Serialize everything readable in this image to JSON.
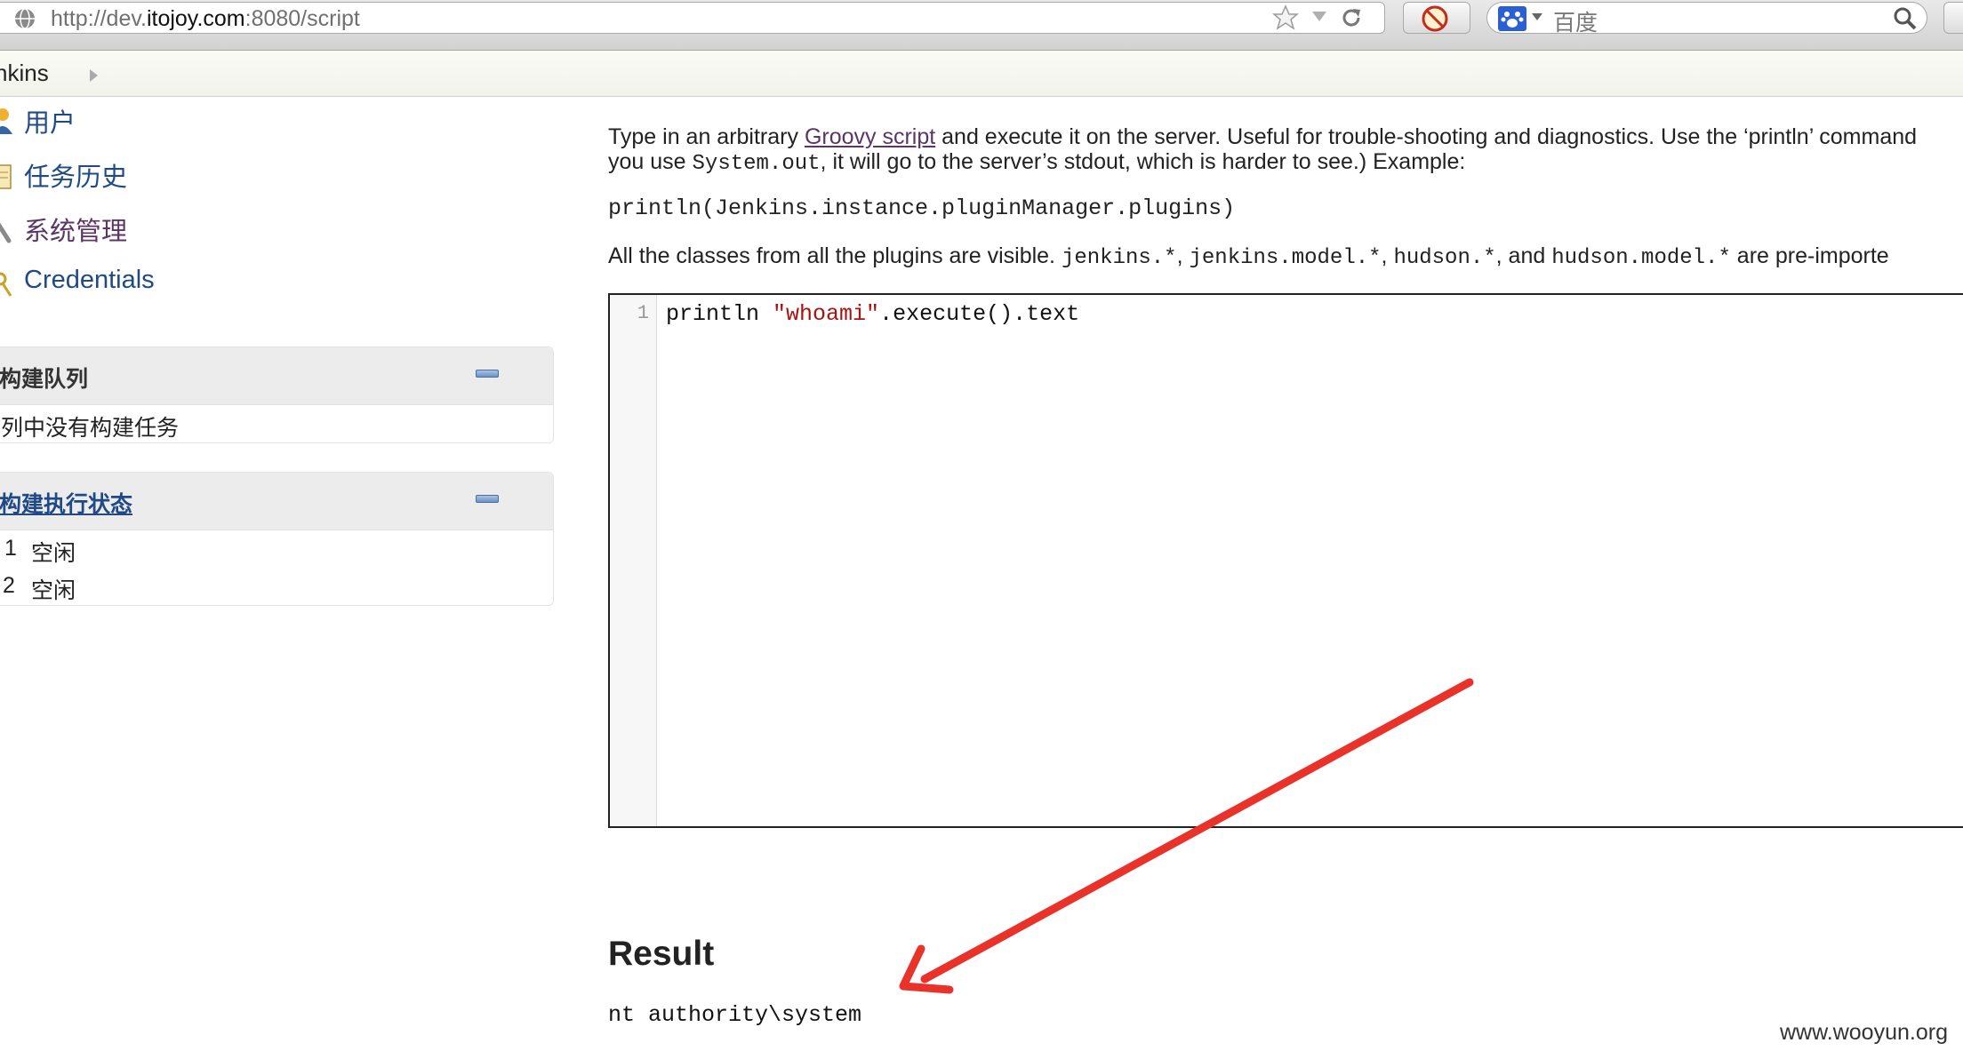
{
  "browser": {
    "url_prefix": "http://dev.",
    "url_domain": "itojoy.com",
    "url_suffix": ":8080/script",
    "search_placeholder": "百度"
  },
  "breadcrumb": {
    "root": "nkins"
  },
  "sidebar": {
    "tasks": [
      {
        "label": "用户",
        "icon": "user-icon"
      },
      {
        "label": "任务历史",
        "icon": "notepad-icon"
      },
      {
        "label": "系统管理",
        "icon": "wrench-icon"
      },
      {
        "label": "Credentials",
        "icon": "key-icon"
      }
    ],
    "build_queue": {
      "title": "构建队列",
      "empty_text": "列中没有构建任务"
    },
    "executors": {
      "title": "构建执行状态",
      "rows": [
        {
          "num": "1",
          "status": "空闲"
        },
        {
          "num": "2",
          "status": "空闲"
        }
      ]
    }
  },
  "main": {
    "intro_1": "Type in an arbitrary ",
    "intro_link": "Groovy script",
    "intro_2": " and execute it on the server. Useful for trouble-shooting and diagnostics. Use the ‘println’ command",
    "intro_line2_1": "you use ",
    "intro_line2_code": "System.out",
    "intro_line2_2": ", it will go to the server’s stdout, which is harder to see.) Example:",
    "example_code": "println(Jenkins.instance.pluginManager.plugins)",
    "classes_1": "All the classes from all the plugins are visible. ",
    "classes_code1": "jenkins.*",
    "classes_sep1": ", ",
    "classes_code2": "jenkins.model.*",
    "classes_sep2": ", ",
    "classes_code3": "hudson.*",
    "classes_sep3": ", and ",
    "classes_code4": "hudson.model.*",
    "classes_2": " are pre-importe",
    "editor": {
      "line_number": "1",
      "code_before": "println ",
      "code_string": "\"whoami\"",
      "code_after": ".execute().text"
    },
    "result_heading": "Result",
    "result_output": "nt authority\\system"
  },
  "watermark": "www.wooyun.org",
  "colors": {
    "link": "#204a87",
    "visited_link": "#5c3566",
    "annotation_arrow": "#e8322a"
  }
}
